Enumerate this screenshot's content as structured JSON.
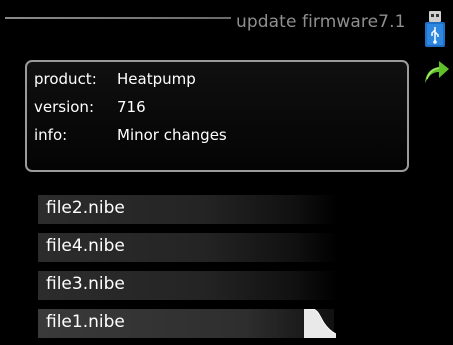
{
  "header": {
    "title": "update firmware7.1"
  },
  "icons": {
    "usb": "usb-icon",
    "back": "back-arrow-icon"
  },
  "info": {
    "product_label": "product:",
    "product_value": "Heatpump",
    "version_label": "version:",
    "version_value": "716",
    "info_label": "info:",
    "info_value": "Minor changes"
  },
  "files": [
    "file2.nibe",
    "file4.nibe",
    "file3.nibe",
    "file1.nibe"
  ],
  "colors": {
    "accent_green": "#5fc02a",
    "usb_blue": "#1f6fc7",
    "frame": "#9b9b9b"
  }
}
